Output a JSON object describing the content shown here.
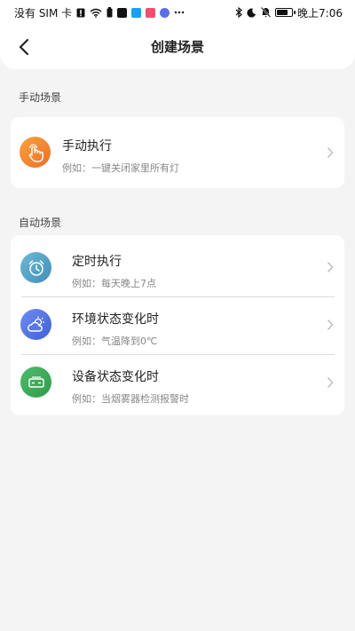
{
  "status_bar": {
    "carrier": "没有 SIM 卡",
    "time": "晚上7:06",
    "battery_level": 0.8,
    "left_icons": [
      "alert-icon",
      "wifi-icon",
      "battery-saver-icon",
      "tiktok-app-icon",
      "q-app-icon",
      "app-icon",
      "music-app-icon",
      "more-icon"
    ],
    "right_icons": [
      "bluetooth-icon",
      "moon-icon",
      "mute-icon",
      "battery-icon"
    ]
  },
  "header": {
    "title": "创建场景",
    "back_icon": "back-arrow-icon"
  },
  "manual_section": {
    "label": "手动场景",
    "items": [
      {
        "title": "手动执行",
        "subtitle": "例如：一键关闭家里所有灯",
        "icon": "hand-tap-icon",
        "color": "#f08a2c"
      }
    ]
  },
  "auto_section": {
    "label": "自动场景",
    "items": [
      {
        "title": "定时执行",
        "subtitle": "例如：每天晚上7点",
        "icon": "alarm-clock-icon",
        "color": "#4fa3c7"
      },
      {
        "title": "环境状态变化时",
        "subtitle": "例如：气温降到0℃",
        "icon": "weather-cloud-icon",
        "color": "#4f6fe0"
      },
      {
        "title": "设备状态变化时",
        "subtitle": "例如：当烟雾器检测报警时",
        "icon": "device-icon",
        "color": "#3aa55a"
      }
    ]
  }
}
